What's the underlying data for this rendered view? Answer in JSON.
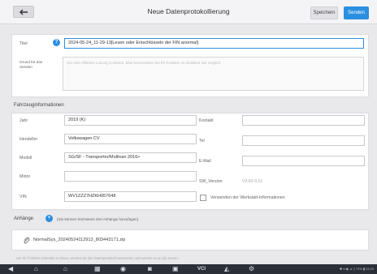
{
  "header": {
    "title": "Neue Datenprotokollierung",
    "save_label": "Speichern",
    "send_label": "Senden"
  },
  "form": {
    "title_label": "Titel",
    "title_value": "2024-05-24_11-29-13[Lesen oder Entschlüsseln der FIN anormal]",
    "reason_label": "Grund für das Senden",
    "reason_placeholder": "Um eine effektive Lösung zu bieten, bitte beschreiben Sie Ihr Problem so detailliert wie möglich."
  },
  "vehicle": {
    "section_title": "Fahrzeuginformationen",
    "left": [
      {
        "label": "Jahr",
        "value": "2019 (K)"
      },
      {
        "label": "Hersteller",
        "value": "Volkswagen CV"
      },
      {
        "label": "Modell",
        "value": "SG/SF - Transporter/Multivan 2016>"
      },
      {
        "label": "Motor",
        "value": ""
      },
      {
        "label": "VIN",
        "value": "WV1ZZZ7HZKH057648"
      }
    ],
    "right": [
      {
        "label": "Kontakt",
        "value": ""
      },
      {
        "label": "Tel",
        "value": ""
      },
      {
        "label": "E-Mail",
        "value": ""
      }
    ],
    "sw_label": "SW_Version",
    "sw_value": "V3.60-9.51",
    "workshop_checkbox_label": "Verwenden der Werkstatt-Informationen",
    "workshop_checked": false
  },
  "attachments": {
    "label": "Anhänge",
    "hint": "(Sie können höchstens drei Anhänge hinzufügen)",
    "file_name": "NormalSys_20240524112913_803443171.zip",
    "notice": "Um Ihr Problem schneller zu lösen, werden wir das Datenprotokoll verwenden und werden es an die Server..."
  },
  "statusbar": {
    "text": "✱ ▾ ◉ ⊿ ▯ 74% ▮ 11:29"
  },
  "icons": {
    "back": "arrow-left-icon",
    "info": "info-icon",
    "attachment": "paperclip-icon"
  },
  "colors": {
    "accent": "#2b8fe0",
    "navbar": "#2b3038"
  }
}
